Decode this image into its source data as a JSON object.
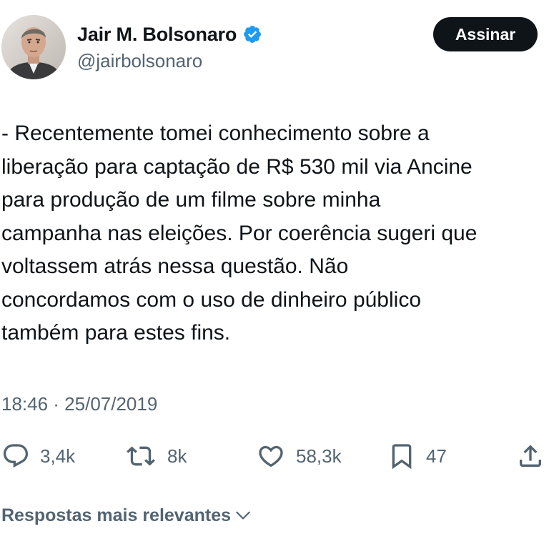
{
  "author": {
    "display_name": "Jair M. Bolsonaro",
    "handle": "@jairbolsonaro",
    "verified": true
  },
  "subscribe_button": {
    "label": "Assinar"
  },
  "tweet": {
    "lines": [
      "- Recentemente tomei conhecimento sobre a",
      "liberação para captação de R$ 530 mil via Ancine",
      "para produção de um filme sobre minha",
      "campanha nas eleições. Por coerência sugeri que",
      "voltassem atrás nessa questão. Não",
      "concordamos com o uso de dinheiro público",
      "também para estes fins."
    ],
    "timestamp": "18:46 · 25/07/2019"
  },
  "actions": {
    "reply": {
      "icon": "reply-icon",
      "count": "3,4k"
    },
    "repost": {
      "icon": "repost-icon",
      "count": "8k"
    },
    "like": {
      "icon": "heart-icon",
      "count": "58,3k"
    },
    "bookmark": {
      "icon": "bookmark-icon",
      "count": "47"
    },
    "share": {
      "icon": "share-icon"
    }
  },
  "replies_sort": {
    "label": "Respostas mais relevantes",
    "icon": "chevron-down-icon"
  },
  "colors": {
    "text_primary": "#0f1419",
    "text_secondary": "#536471",
    "verified_blue": "#1d9bf0",
    "button_background": "#0f1419",
    "button_text": "#ffffff"
  }
}
